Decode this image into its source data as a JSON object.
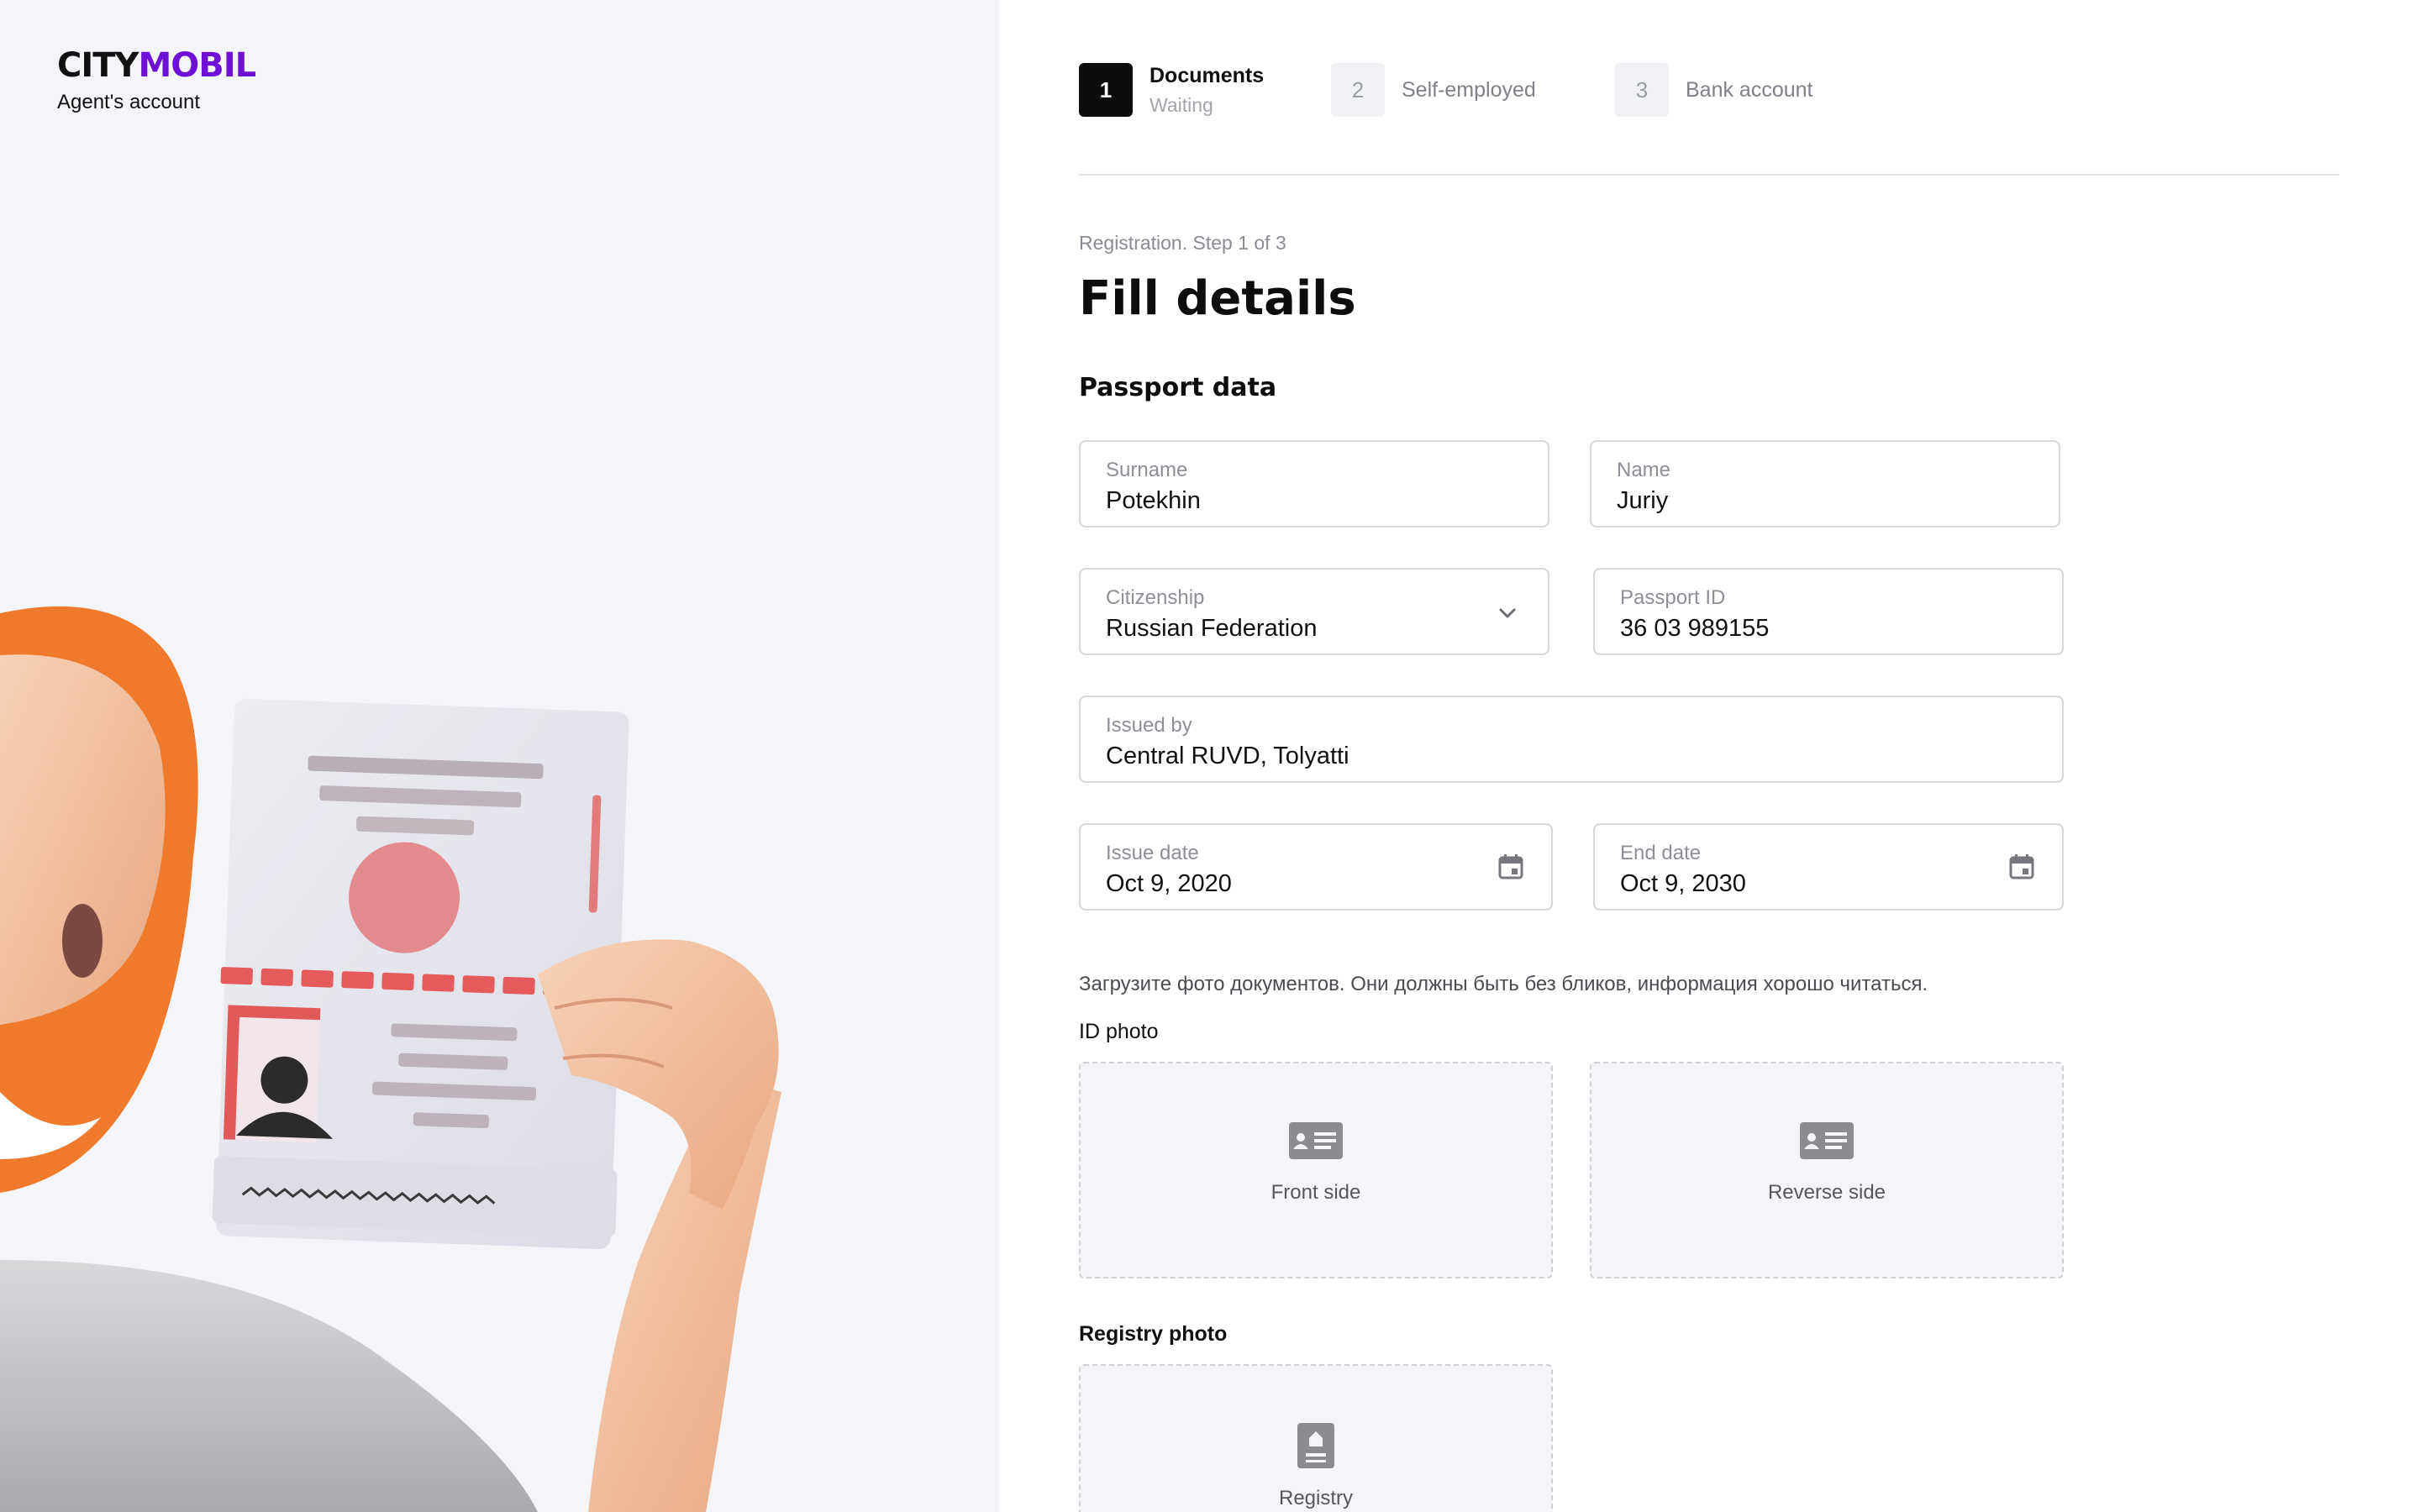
{
  "brand": {
    "logo_city": "CITY",
    "logo_mobil": "MOBIL",
    "subtitle": "Agent's account"
  },
  "steps": [
    {
      "number": "1",
      "title": "Documents",
      "subtitle": "Waiting",
      "active": true
    },
    {
      "number": "2",
      "title": "Self-employed",
      "active": false
    },
    {
      "number": "3",
      "title": "Bank account",
      "active": false
    }
  ],
  "breadcrumb": "Registration. Step 1 of 3",
  "title": "Fill details",
  "passport": {
    "section_title": "Passport data",
    "surname": {
      "label": "Surname",
      "value": "Potekhin"
    },
    "name": {
      "label": "Name",
      "value": "Juriy"
    },
    "citizenship": {
      "label": "Citizenship",
      "value": "Russian Federation",
      "icon": "chevron-down-icon"
    },
    "passport_id": {
      "label": "Passport ID",
      "value": "36 03 989155"
    },
    "issued_by": {
      "label": "Issued by",
      "value": "Central RUVD, Tolyatti"
    },
    "issue_date": {
      "label": "Issue date",
      "value": "Oct 9, 2020",
      "icon": "calendar-icon"
    },
    "end_date": {
      "label": "End date",
      "value": "Oct 9, 2030",
      "icon": "calendar-icon"
    }
  },
  "photos": {
    "hint": "Загрузите фото документов. Они должны быть без бликов, информация хорошо читаться.",
    "id_label": "ID photo",
    "front_label": "Front side",
    "reverse_label": "Reverse side",
    "registry_section": "Registry photo",
    "registry_label": "Registry",
    "id_icon": "id-card-icon",
    "registry_icon": "registry-book-icon"
  },
  "colors": {
    "brand_purple": "#6e10d6",
    "active_step": "#0d0d0d",
    "beard_orange": "#f07a2c",
    "passport_red": "#e55a5a"
  }
}
